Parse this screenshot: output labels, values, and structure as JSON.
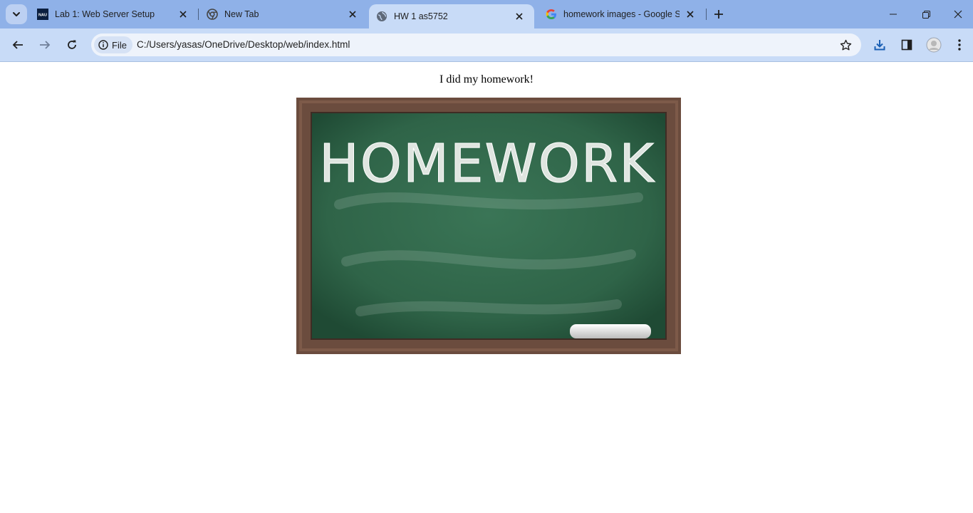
{
  "tabs": [
    {
      "title": "Lab 1: Web Server Setup",
      "icon": "nau-logo-icon",
      "logo_text": "NAU"
    },
    {
      "title": "New Tab",
      "icon": "chrome-icon"
    },
    {
      "title": "HW 1 as5752",
      "icon": "globe-icon"
    },
    {
      "title": "homework images - Google Sea",
      "icon": "google-icon"
    }
  ],
  "omnibox": {
    "scheme_label": "File",
    "url": "C:/Users/yasas/OneDrive/Desktop/web/index.html"
  },
  "page": {
    "caption": "I did my homework!",
    "image": {
      "chalk_text": "HOMEWORK",
      "board_color": "#2f6448",
      "frame_color": "#6b4c3e"
    }
  },
  "colors": {
    "tabstrip": "#8fb1e8",
    "active_tab": "#c8dbf7",
    "toolbar": "#c8dbf7",
    "download_accent": "#1a5fb4"
  }
}
